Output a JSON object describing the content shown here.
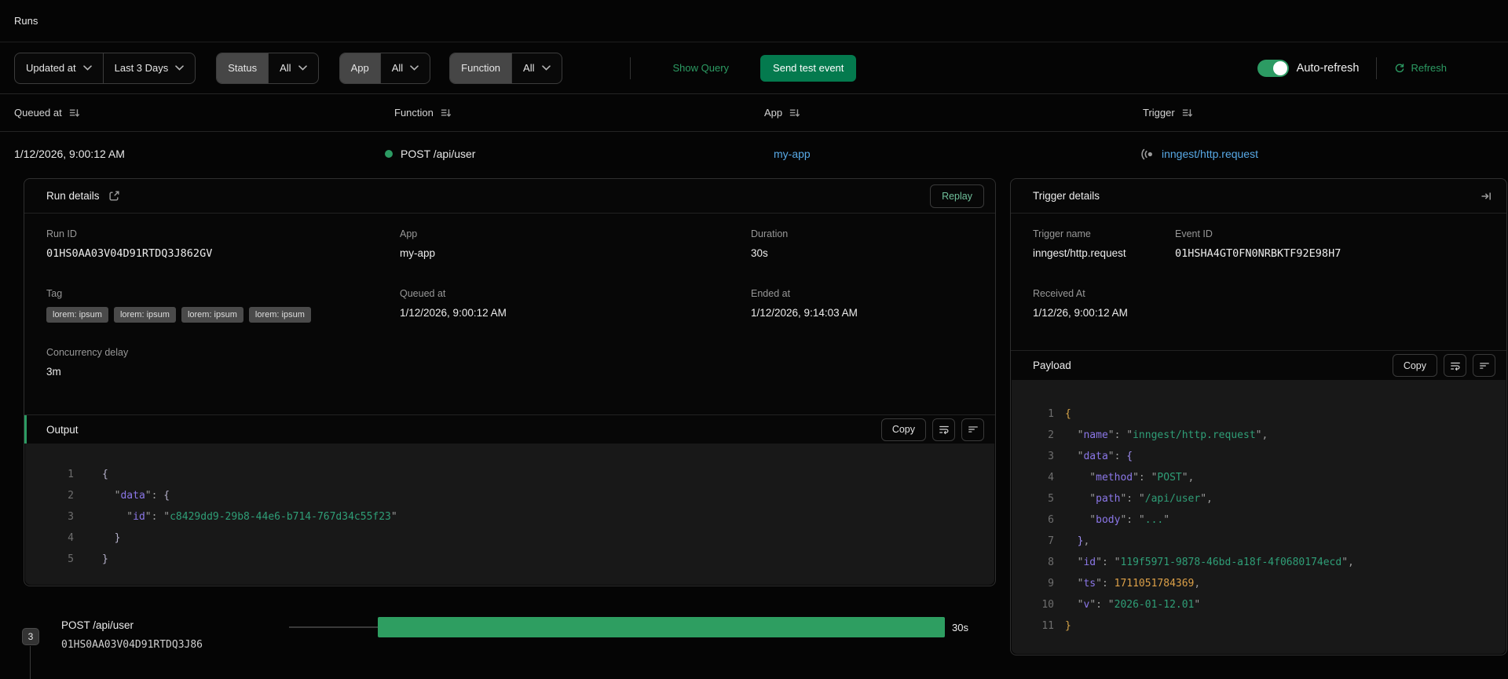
{
  "colors": {
    "accent_green": "#2c9b63",
    "button_green": "#047a4e",
    "link_blue": "#58a9e6",
    "bar_green": "#2e9e61",
    "status_dot": "#2c9b63"
  },
  "topbar": {
    "title": "Runs"
  },
  "filters": {
    "sort": {
      "label": "Updated at"
    },
    "range": {
      "label": "Last 3 Days"
    },
    "status": {
      "label": "Status",
      "value": "All"
    },
    "app": {
      "label": "App",
      "value": "All"
    },
    "function": {
      "label": "Function",
      "value": "All"
    },
    "show_query_label": "Show Query",
    "send_test_label": "Send test event",
    "auto_refresh_label": "Auto-refresh",
    "auto_refresh_enabled": true,
    "refresh_label": "Refresh"
  },
  "table": {
    "columns": [
      "Queued at",
      "Function",
      "App",
      "Trigger"
    ],
    "row": {
      "queued_at": "1/12/2026, 9:00:12 AM",
      "function": "POST /api/user",
      "app": "my-app",
      "trigger": "inngest/http.request"
    }
  },
  "run_details": {
    "title": "Run details",
    "replay_label": "Replay",
    "run_id": {
      "label": "Run ID",
      "value": "01HS0AA03V04D91RTDQ3J862GV"
    },
    "app": {
      "label": "App",
      "value": "my-app"
    },
    "duration": {
      "label": "Duration",
      "value": "30s"
    },
    "tag": {
      "label": "Tag",
      "items": [
        "lorem: ipsum",
        "lorem: ipsum",
        "lorem: ipsum",
        "lorem: ipsum"
      ]
    },
    "queued_at": {
      "label": "Queued at",
      "value": "1/12/2026, 9:00:12 AM"
    },
    "ended_at": {
      "label": "Ended at",
      "value": "1/12/2026, 9:14:03 AM"
    },
    "concurrency": {
      "label": "Concurrency delay",
      "value": "3m"
    },
    "output": {
      "title": "Output",
      "copy_label": "Copy",
      "code": [
        {
          "n": "1",
          "s": [
            [
              "brl",
              "{"
            ]
          ]
        },
        {
          "n": "2",
          "s": [
            [
              "pun",
              "  \""
            ],
            [
              "key",
              "data"
            ],
            [
              "pun",
              "\": "
            ],
            [
              "brl",
              "{"
            ]
          ]
        },
        {
          "n": "3",
          "s": [
            [
              "pun",
              "    \""
            ],
            [
              "key",
              "id"
            ],
            [
              "pun",
              "\": \""
            ],
            [
              "str",
              "c8429dd9-29b8-44e6-b714-767d34c55f23"
            ],
            [
              "pun",
              "\""
            ]
          ]
        },
        {
          "n": "4",
          "s": [
            [
              "brl",
              "  }"
            ]
          ]
        },
        {
          "n": "5",
          "s": [
            [
              "brl",
              "}"
            ]
          ]
        }
      ]
    }
  },
  "trigger_details": {
    "title": "Trigger details",
    "trigger_name": {
      "label": "Trigger name",
      "value": "inngest/http.request"
    },
    "event_id": {
      "label": "Event ID",
      "value": "01HSHA4GT0FN0NRBKTF92E98H7"
    },
    "received_at": {
      "label": "Received At",
      "value": "1/12/26, 9:00:12 AM"
    },
    "payload": {
      "title": "Payload",
      "copy_label": "Copy",
      "code": [
        {
          "n": "1",
          "s": [
            [
              "bry",
              "{"
            ]
          ]
        },
        {
          "n": "2",
          "s": [
            [
              "pun",
              "  \""
            ],
            [
              "key",
              "name"
            ],
            [
              "pun",
              "\": \""
            ],
            [
              "str",
              "inngest/http.request"
            ],
            [
              "pun",
              "\","
            ]
          ]
        },
        {
          "n": "3",
          "s": [
            [
              "pun",
              "  \""
            ],
            [
              "key",
              "data"
            ],
            [
              "pun",
              "\": "
            ],
            [
              "brp",
              "{"
            ]
          ]
        },
        {
          "n": "4",
          "s": [
            [
              "pun",
              "    \""
            ],
            [
              "key",
              "method"
            ],
            [
              "pun",
              "\": \""
            ],
            [
              "str",
              "POST"
            ],
            [
              "pun",
              "\","
            ]
          ]
        },
        {
          "n": "5",
          "s": [
            [
              "pun",
              "    \""
            ],
            [
              "key",
              "path"
            ],
            [
              "pun",
              "\": \""
            ],
            [
              "str",
              "/api/user"
            ],
            [
              "pun",
              "\","
            ]
          ]
        },
        {
          "n": "6",
          "s": [
            [
              "pun",
              "    \""
            ],
            [
              "key",
              "body"
            ],
            [
              "pun",
              "\": \""
            ],
            [
              "str",
              "..."
            ],
            [
              "pun",
              "\""
            ]
          ]
        },
        {
          "n": "7",
          "s": [
            [
              "brp",
              "  }"
            ],
            [
              "pun",
              ","
            ]
          ]
        },
        {
          "n": "8",
          "s": [
            [
              "pun",
              "  \""
            ],
            [
              "key",
              "id"
            ],
            [
              "pun",
              "\": \""
            ],
            [
              "str",
              "119f5971-9878-46bd-a18f-4f0680174ecd"
            ],
            [
              "pun",
              "\","
            ]
          ]
        },
        {
          "n": "9",
          "s": [
            [
              "pun",
              "  \""
            ],
            [
              "key",
              "ts"
            ],
            [
              "pun",
              "\": "
            ],
            [
              "num",
              "1711051784369"
            ],
            [
              "pun",
              ","
            ]
          ]
        },
        {
          "n": "10",
          "s": [
            [
              "pun",
              "  \""
            ],
            [
              "key",
              "v"
            ],
            [
              "pun",
              "\": \""
            ],
            [
              "str",
              "2026-01-12.01"
            ],
            [
              "pun",
              "\""
            ]
          ]
        },
        {
          "n": "11",
          "s": [
            [
              "bry",
              "}"
            ]
          ]
        }
      ]
    }
  },
  "timeline": {
    "step_count": "3",
    "function": "POST /api/user",
    "run_id": "01HS0AA03V04D91RTDQ3J86",
    "duration": "30s"
  }
}
